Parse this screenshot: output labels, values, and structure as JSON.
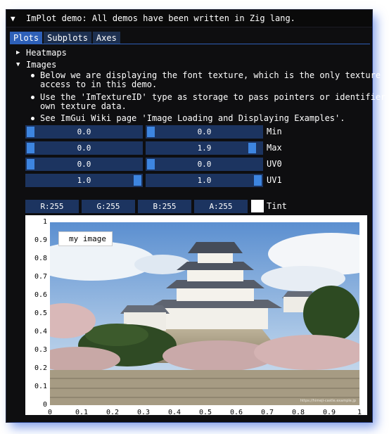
{
  "window": {
    "title": "ImPlot demo: All demos have been written in Zig lang."
  },
  "tabs": [
    "Plots",
    "Subplots",
    "Axes"
  ],
  "tree": {
    "heatmaps": "Heatmaps",
    "images": "Images"
  },
  "bullets": [
    {
      "line1": "Below we are displaying the font texture, which is the only texture",
      "line2": "access to in this demo."
    },
    {
      "line1": "Use the 'ImTextureID' type as storage to pass pointers or identifier",
      "line2": "own texture data."
    },
    {
      "line1": "See ImGui Wiki page 'Image Loading and Displaying Examples'.",
      "line2": ""
    }
  ],
  "sliders": [
    {
      "a": "0.0",
      "a_frac": 0.0,
      "b": "0.0",
      "b_frac": 0.0,
      "label": "Min"
    },
    {
      "a": "0.0",
      "a_frac": 0.0,
      "b": "1.9",
      "b_frac": 0.95,
      "label": "Max"
    },
    {
      "a": "0.0",
      "a_frac": 0.0,
      "b": "0.0",
      "b_frac": 0.0,
      "label": "UV0"
    },
    {
      "a": "1.0",
      "a_frac": 1.0,
      "b": "1.0",
      "b_frac": 1.0,
      "label": "UV1"
    }
  ],
  "tint": {
    "r": "R:255",
    "g": "G:255",
    "b": "B:255",
    "a": "A:255",
    "label": "Tint",
    "color": "#ffffff"
  },
  "plot": {
    "legend": "my image",
    "y_ticks": [
      "1",
      "0.9",
      "0.8",
      "0.7",
      "0.6",
      "0.5",
      "0.4",
      "0.3",
      "0.2",
      "0.1",
      "0"
    ],
    "x_ticks": [
      "0",
      "0.1",
      "0.2",
      "0.3",
      "0.4",
      "0.5",
      "0.6",
      "0.7",
      "0.8",
      "0.9",
      "1"
    ],
    "watermark": "https://himeji-castle.example.jp"
  },
  "colors": {
    "accent": "#2e60b8",
    "frame": "#1c3460",
    "grab": "#3d85e0"
  }
}
